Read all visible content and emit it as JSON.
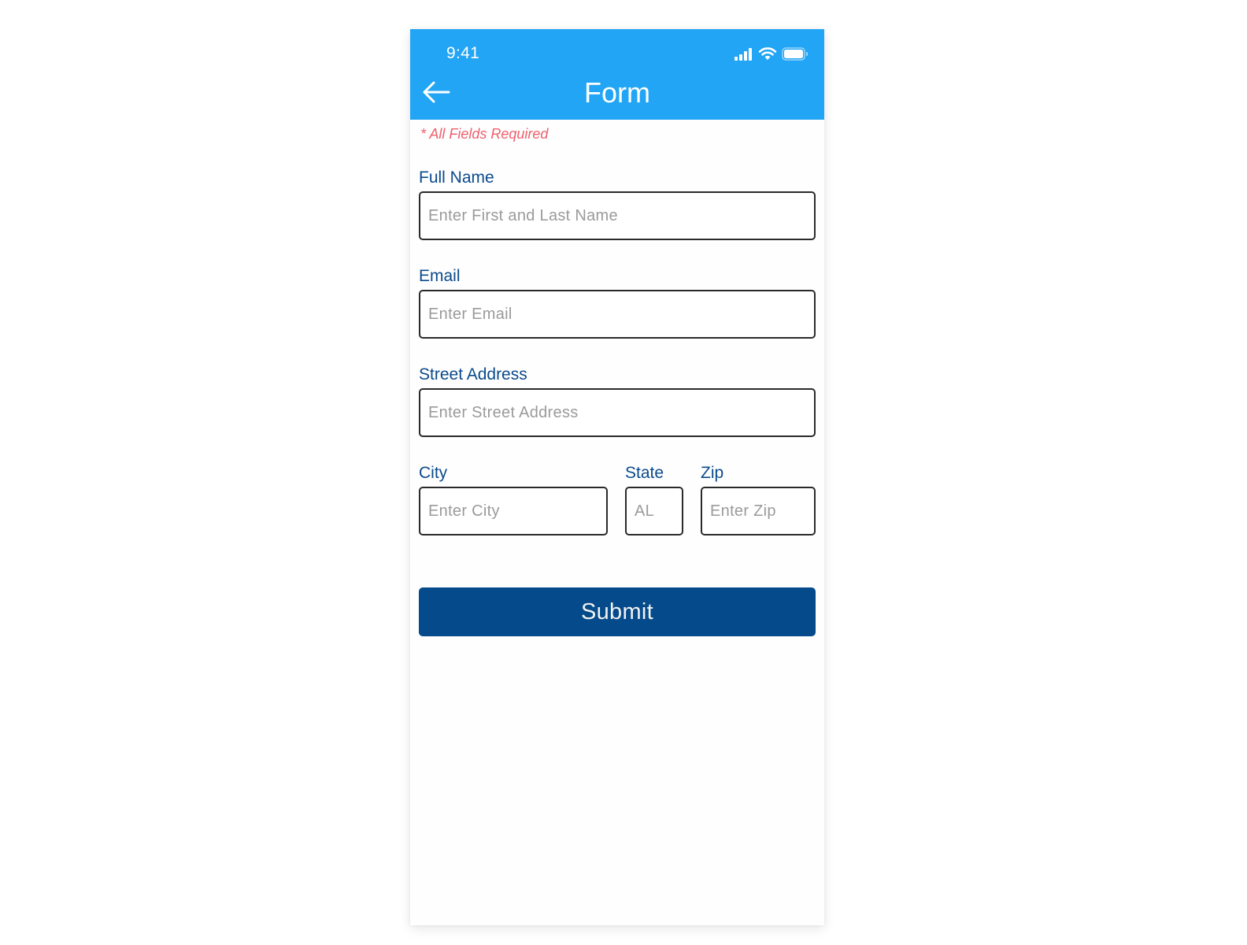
{
  "status_bar": {
    "time": "9:41",
    "icons": [
      "signal-icon",
      "wifi-icon",
      "battery-icon"
    ]
  },
  "header": {
    "back_icon": "arrow-left-icon",
    "title": "Form",
    "background_color": "#22a5f4"
  },
  "form": {
    "required_note": "* All Fields Required",
    "fields": {
      "full_name": {
        "label": "Full Name",
        "placeholder": "Enter First and Last Name",
        "value": ""
      },
      "email": {
        "label": "Email",
        "placeholder": "Enter Email",
        "value": ""
      },
      "street_address": {
        "label": "Street Address",
        "placeholder": "Enter Street Address",
        "value": ""
      },
      "city": {
        "label": "City",
        "placeholder": "Enter City",
        "value": ""
      },
      "state": {
        "label": "State",
        "placeholder": "AL",
        "value": ""
      },
      "zip": {
        "label": "Zip",
        "placeholder": "Enter Zip",
        "value": ""
      }
    },
    "submit_label": "Submit",
    "label_color": "#0a4a8c",
    "required_color": "#ef5f6d",
    "submit_color": "#054a8a"
  }
}
